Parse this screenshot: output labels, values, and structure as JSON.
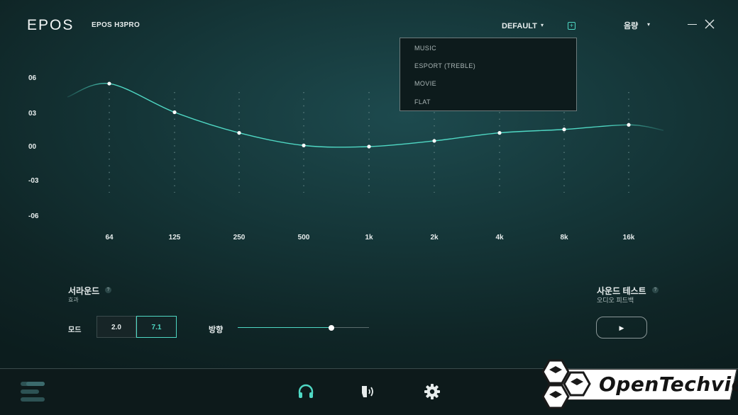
{
  "header": {
    "logo": "EPOS",
    "model": "EPOS H3PRO",
    "preset_label": "DEFAULT",
    "preset_caret": "▾",
    "add_icon": "+",
    "volume_label": "음량",
    "volume_caret": "▾"
  },
  "preset_menu": {
    "items": [
      "MUSIC",
      "ESPORT (TREBLE)",
      "MOVIE",
      "FLAT"
    ]
  },
  "equalizer": {
    "y_labels": [
      "06",
      "03",
      "00",
      "-03",
      "-06"
    ],
    "x_labels": [
      "64",
      "125",
      "250",
      "500",
      "1k",
      "2k",
      "4k",
      "8k",
      "16k"
    ],
    "gains_db": [
      5.5,
      3.0,
      1.2,
      0.1,
      0.0,
      0.5,
      1.2,
      1.5,
      1.9
    ],
    "y_range": [
      -6,
      6
    ],
    "accent_color": "#4fd8c4"
  },
  "surround": {
    "title": "서라운드",
    "help": "?",
    "subtitle": "효과",
    "mode_label": "모드",
    "mode_2_0": "2.0",
    "mode_7_1": "7.1",
    "selected_mode": "7.1",
    "direction_label": "방향",
    "direction_value": 0.7
  },
  "sound_test": {
    "title": "사운드 테스트",
    "help": "?",
    "subtitle": "오디오 피드백",
    "play_icon": "▶"
  },
  "footer": {
    "icons": [
      "menu-icon",
      "headphones-icon",
      "microphone-icon",
      "settings-icon"
    ],
    "active": "headphones-icon"
  },
  "watermark": {
    "text": "OpenTechview"
  }
}
